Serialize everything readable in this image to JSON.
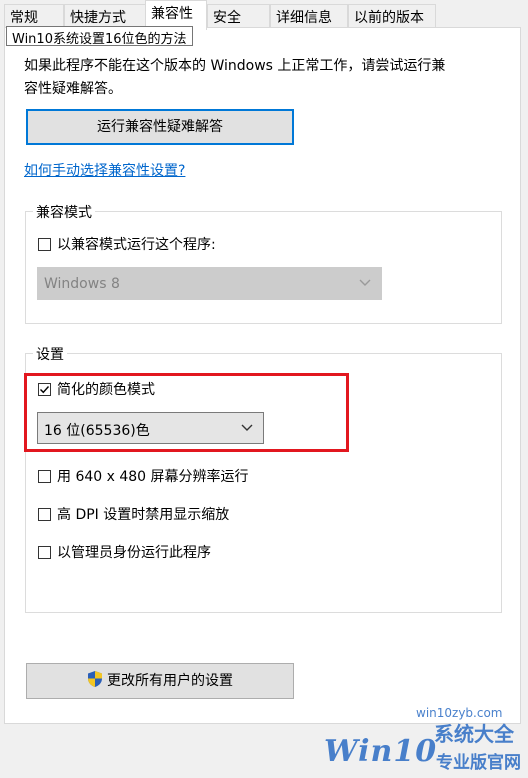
{
  "tabs": [
    {
      "label": "常规"
    },
    {
      "label": "快捷方式"
    },
    {
      "label": "兼容性"
    },
    {
      "label": "安全"
    },
    {
      "label": "详细信息"
    },
    {
      "label": "以前的版本"
    }
  ],
  "tooltip": "Win10系统设置16位色的方法",
  "intro": {
    "line1": "如果此程序不能在这个版本的 Windows 上正常工作，请尝试运行兼",
    "line2": "容性疑难解答。"
  },
  "troubleshoot_button": "运行兼容性疑难解答",
  "manual_link": "如何手动选择兼容性设置?",
  "compat_mode": {
    "title": "兼容模式",
    "checkbox_label": "以兼容模式运行这个程序:",
    "checked": false,
    "os_select": "Windows 8"
  },
  "settings": {
    "title": "设置",
    "reduced_color": {
      "label": "简化的颜色模式",
      "checked": true
    },
    "color_select": "16 位(65536)色",
    "options": [
      {
        "label": "用 640 x 480 屏幕分辨率运行",
        "checked": false
      },
      {
        "label": "高 DPI 设置时禁用显示缩放",
        "checked": false
      },
      {
        "label": "以管理员身份运行此程序",
        "checked": false
      }
    ]
  },
  "all_users_button": "更改所有用户的设置",
  "watermark": {
    "site": "win10zyb.com",
    "brand": "Win10",
    "cn_top": "系统大全",
    "cn_bottom": "专业版官网"
  },
  "colors": {
    "accent": "#0078d7",
    "link": "#0066cc",
    "highlight_box": "#e2171f",
    "watermark": "#2b6cc4"
  }
}
